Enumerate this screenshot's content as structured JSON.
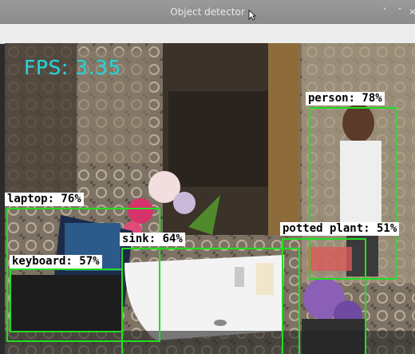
{
  "window": {
    "title": "Object detector"
  },
  "window_controls": {
    "minimize": "˅",
    "maximize": "˄",
    "close": "×"
  },
  "overlay": {
    "fps": "FPS: 3.35"
  },
  "detections": [
    {
      "label": "person: 78%"
    },
    {
      "label": "laptop: 76%"
    },
    {
      "label": "sink: 64%"
    },
    {
      "label": "keyboard: 57%"
    },
    {
      "label": "potted plant: 51%"
    }
  ],
  "colors": {
    "box": "#22dd22",
    "fps": "#2ecfd8",
    "label_bg": "#ffffff"
  }
}
